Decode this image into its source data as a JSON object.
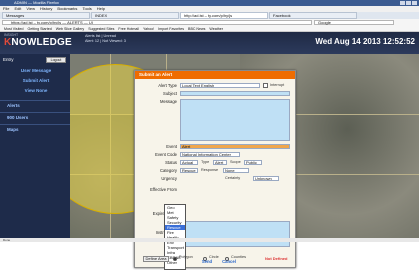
{
  "browser": {
    "title": "ADMIN — Mozilla Firefox",
    "menu": [
      "File",
      "Edit",
      "View",
      "History",
      "Bookmarks",
      "Tools",
      "Help"
    ],
    "tabs": [
      "Messages",
      "INDEX",
      "http://ad.lst – ty.com/p/hy/js",
      "Facebook"
    ],
    "url": "https://ad.lst – ty.com/p/hy/js — ALERTS — UI",
    "search": "Google",
    "bookmarks": [
      "Most Visited",
      "Getting Started",
      "Web Slice Gallery",
      "Suggested Sites",
      "Free Hotmail",
      "Yahoo!",
      "Import Favorites",
      "BBC News",
      "Weather"
    ]
  },
  "app": {
    "logo_prefix": "K",
    "logo_rest": "NOWLEDGE",
    "logo_sub": "INSIGHT",
    "top_left": "Alerts list   |   Unread",
    "top_left2": "Alert: 12   |   Not Viewed: 3",
    "clock": "Wed Aug 14 2013  12:52:52",
    "entry_label": "Entry",
    "login_label": "Logout",
    "side_links": [
      "User Message",
      "Submit Alert",
      "View None"
    ],
    "sections": [
      "Alerts",
      "900 Users",
      "Maps"
    ]
  },
  "dialog": {
    "title": "Submit an Alert",
    "alert_type_label": "Alert Type",
    "alert_type_value": "Local Text English",
    "interrupt_label": "Interrupt",
    "subject_label": "Subject",
    "message_label": "Message",
    "event_label": "Event",
    "event_value": "Alert",
    "event_code_label": "Event Code",
    "event_code_value": "National Information Center",
    "status_label": "Status",
    "status_value": "Actual",
    "type_label": "Type",
    "type_value": "Alert",
    "scope_label": "Scope",
    "scope_value": "Public",
    "category_label": "Category",
    "category_value": "Rescue",
    "response_label": "Response",
    "response_value": "None",
    "urgency_label": "Urgency",
    "certainty_label": "Certainty",
    "certainty_value": "Unknown",
    "effective_label": "Effective From",
    "expire_label": "Expire Hours",
    "instructions_label": "Instructions",
    "dropdown_options": [
      "Geo",
      "Met",
      "Safety",
      "Security",
      "Rescue",
      "Fire",
      "Health",
      "Env",
      "Transport",
      "Infra",
      "CBRNE",
      "Other"
    ],
    "dropdown_selected": "Rescue",
    "define_area_label": "Define Area",
    "polygon_label": "Polygon",
    "circle_label": "Circle",
    "counties_label": "Counties",
    "not_defined": "Not Defined",
    "save_label": "Send",
    "cancel_label": "Cancel"
  },
  "statusbar": "Done"
}
